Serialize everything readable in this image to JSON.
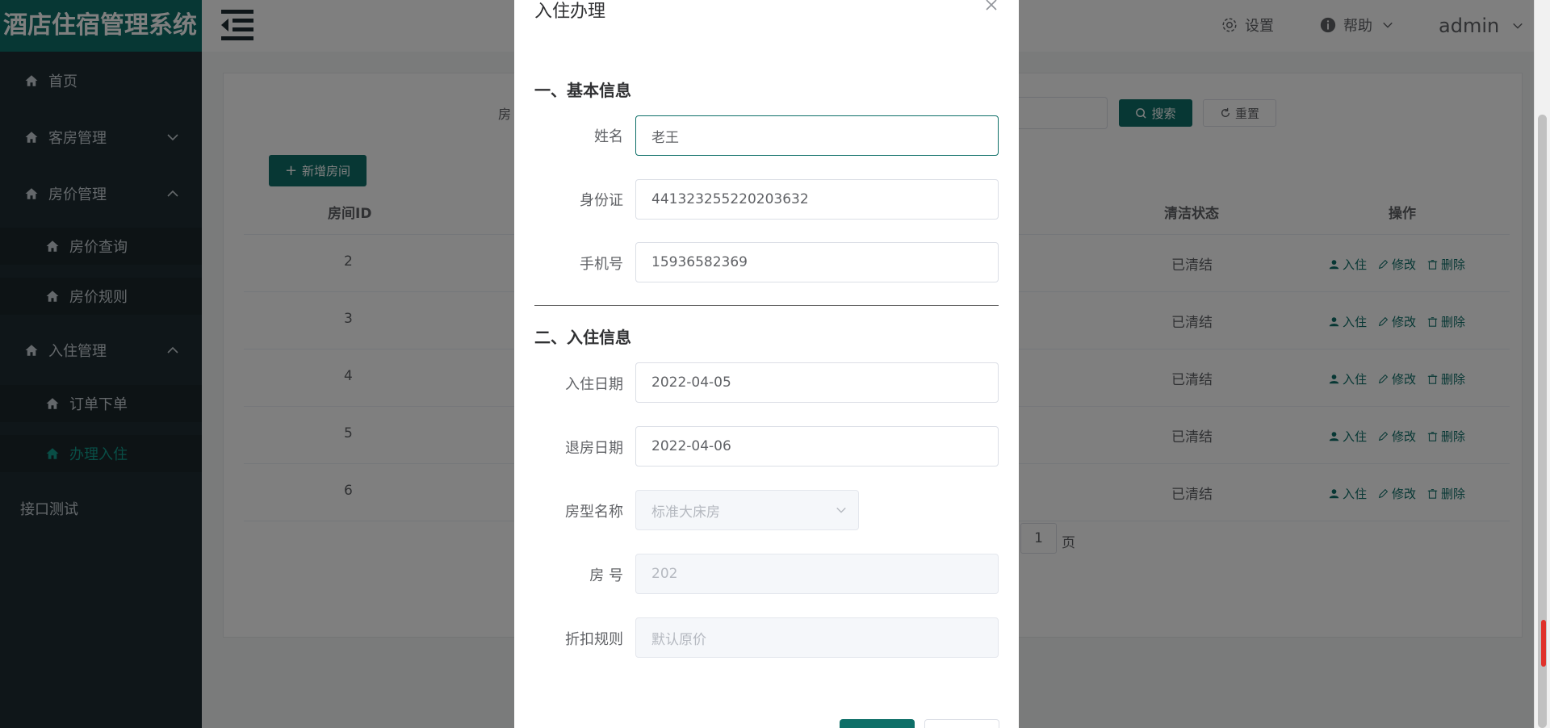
{
  "app_title": "酒店住宿管理系统",
  "sidebar": {
    "items": [
      {
        "label": "首页"
      },
      {
        "label": "客房管理"
      },
      {
        "label": "房价管理"
      },
      {
        "label": "房价查询"
      },
      {
        "label": "房价规则"
      },
      {
        "label": "入住管理"
      },
      {
        "label": "订单下单"
      },
      {
        "label": "办理入住"
      },
      {
        "label": "接口测试"
      }
    ]
  },
  "header": {
    "settings_label": "设置",
    "help_label": "帮助",
    "user_label": "admin"
  },
  "toolbar": {
    "search_label_partial": "房",
    "search_button": "搜索",
    "reset_button": "重置",
    "add_button": "新增房间"
  },
  "table": {
    "columns": [
      "房间ID",
      "清洁状态",
      "操作"
    ],
    "rows": [
      {
        "id": "2",
        "clean": "已清结"
      },
      {
        "id": "3",
        "clean": "已清结"
      },
      {
        "id": "4",
        "clean": "已清结"
      },
      {
        "id": "5",
        "clean": "已清结"
      },
      {
        "id": "6",
        "clean": "已清结"
      }
    ],
    "actions": {
      "checkin": "入住",
      "edit": "修改",
      "delete": "删除"
    }
  },
  "pager": {
    "page": "1",
    "suffix": "页"
  },
  "dialog": {
    "title": "入住办理",
    "section1": "一、基本信息",
    "section2": "二、入住信息",
    "fields": {
      "name": {
        "label": "姓名",
        "value": "老王"
      },
      "idcard": {
        "label": "身份证",
        "value": "441323255220203632"
      },
      "phone": {
        "label": "手机号",
        "value": "15936582369"
      },
      "checkin_date": {
        "label": "入住日期",
        "value": "2022-04-05"
      },
      "checkout_date": {
        "label": "退房日期",
        "value": "2022-04-06"
      },
      "room_type": {
        "label": "房型名称",
        "value": "标准大床房"
      },
      "room_no": {
        "label": "房 号",
        "value": "202"
      },
      "discount": {
        "label": "折扣规则",
        "value": "默认原价"
      }
    }
  },
  "colors": {
    "primary": "#0e6f68",
    "sidebar_bg": "#1f2d33",
    "active_menu": "#129c8d"
  }
}
